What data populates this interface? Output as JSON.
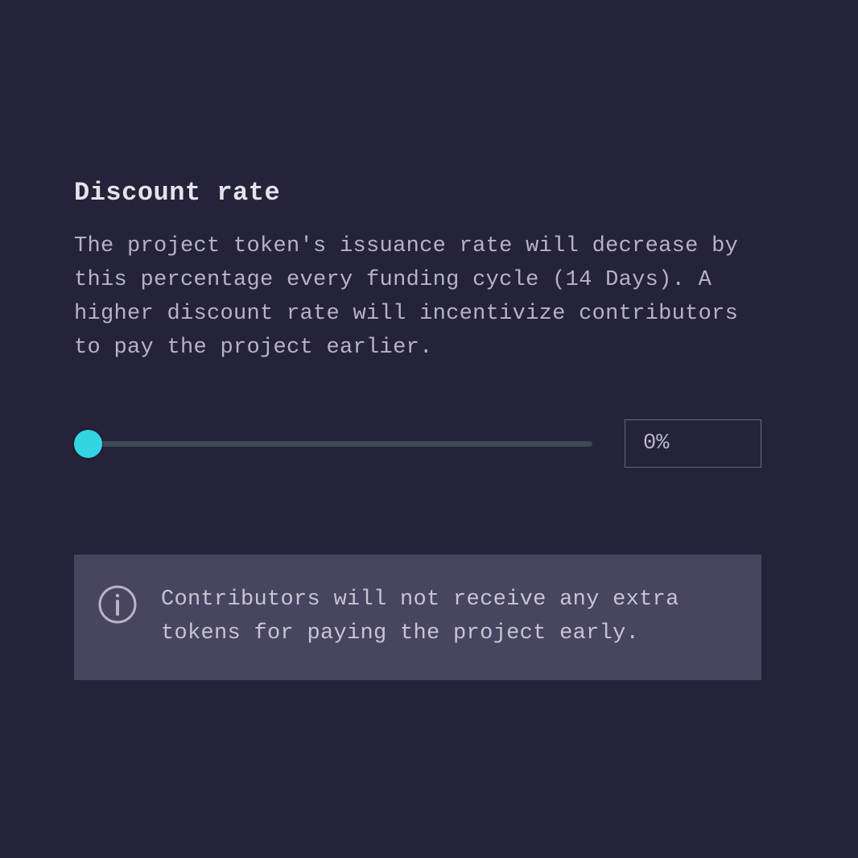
{
  "heading": "Discount rate",
  "description": "The project token's issuance rate will decrease by this percentage every funding cycle (14 Days). A higher discount rate will incentivize contributors to pay the project earlier.",
  "slider": {
    "value": 0,
    "display": "0%"
  },
  "info": {
    "message": "Contributors will not receive any extra tokens for paying the project early."
  }
}
